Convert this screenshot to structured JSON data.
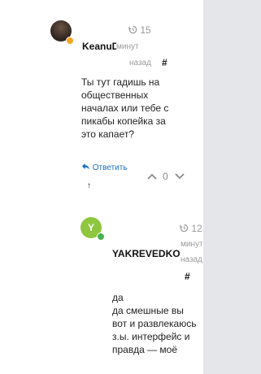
{
  "comments": [
    {
      "author": "KeanuDar",
      "time_value": "15",
      "time_unit_1": "минут",
      "time_unit_2": "назад",
      "hash": "#",
      "text_lines": [
        "Ты тут гадишь на",
        "общественных",
        "началах или тебе с",
        "пикабы копейка за",
        "это капает?"
      ],
      "reply_label": "Ответить",
      "votes": "0",
      "up_arrow": "↑",
      "avatar_color": "#3a2d25",
      "status_color": "#f5a623"
    },
    {
      "author": "YAKREVEDKO",
      "avatar_letter": "Y",
      "time_value": "12",
      "time_unit_1": "минут",
      "time_unit_2": "назад",
      "hash": "#",
      "text_lines": [
        "да",
        "да смешные вы",
        "вот и развлекаюсь",
        "з.ы. интерфейс и",
        "правда — моё"
      ],
      "avatar_color": "#8ec63f",
      "status_color": "#4caf50"
    }
  ],
  "icons": {
    "time": "history-icon",
    "reply": "reply-icon",
    "vote_up": "chevron-up-icon",
    "vote_down": "chevron-down-icon"
  },
  "colors": {
    "link": "#1a6ec2",
    "sidebar_bg": "#e4e6ea"
  }
}
